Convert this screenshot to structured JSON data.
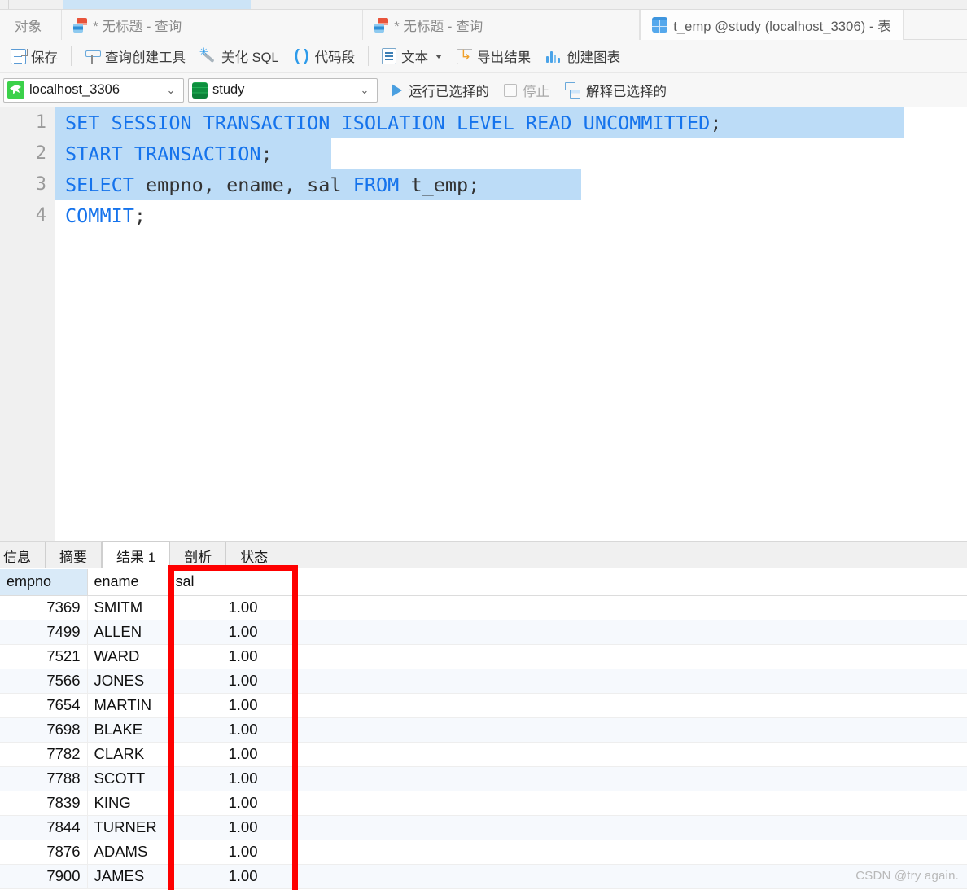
{
  "window": {
    "object_tab_label": "对象"
  },
  "tabs": [
    {
      "label": "* 无标题 - 查询",
      "icon": "query-doc-icon",
      "active": false
    },
    {
      "label": "* 无标题 - 查询",
      "icon": "query-doc-icon",
      "active": false
    },
    {
      "label": "t_emp @study (localhost_3306) - 表",
      "icon": "table-icon",
      "active": true
    }
  ],
  "toolbar": {
    "save_label": "保存",
    "query_builder_label": "查询创建工具",
    "beautify_sql_label": "美化 SQL",
    "code_snippet_label": "代码段",
    "text_label": "文本",
    "export_result_label": "导出结果",
    "create_chart_label": "创建图表"
  },
  "connbar": {
    "connection_value": "localhost_3306",
    "database_value": "study",
    "run_selected_label": "运行已选择的",
    "stop_label": "停止",
    "explain_selected_label": "解释已选择的"
  },
  "editor": {
    "lines": [
      {
        "number": "1",
        "selected": true,
        "sel_width": 1043,
        "tokens": [
          {
            "t": "SET SESSION TRANSACTION ISOLATION LEVEL READ UNCOMMITTED",
            "c": "kw"
          },
          {
            "t": ";",
            "c": "pn"
          }
        ]
      },
      {
        "number": "2",
        "selected": true,
        "sel_width": 340,
        "tokens": [
          {
            "t": "START TRANSACTION",
            "c": "kw"
          },
          {
            "t": ";",
            "c": "pn"
          }
        ]
      },
      {
        "number": "3",
        "selected": true,
        "sel_width": 647,
        "tokens": [
          {
            "t": "SELECT",
            "c": "kw"
          },
          {
            "t": " empno, ename, sal ",
            "c": "id"
          },
          {
            "t": "FROM",
            "c": "kw"
          },
          {
            "t": " t_emp",
            "c": "id"
          },
          {
            "t": ";",
            "c": "pn"
          }
        ]
      },
      {
        "number": "4",
        "selected": false,
        "sel_width": 0,
        "tokens": [
          {
            "t": "COMMIT",
            "c": "kw"
          },
          {
            "t": ";",
            "c": "pn"
          }
        ]
      }
    ]
  },
  "bottom_tabs": [
    {
      "label": "信息",
      "active": false
    },
    {
      "label": "摘要",
      "active": false
    },
    {
      "label": "结果 1",
      "active": true
    },
    {
      "label": "剖析",
      "active": false
    },
    {
      "label": "状态",
      "active": false
    }
  ],
  "result_grid": {
    "columns": [
      "empno",
      "ename",
      "sal",
      ""
    ],
    "rows": [
      [
        "7369",
        "SMITM",
        "1.00",
        ""
      ],
      [
        "7499",
        "ALLEN",
        "1.00",
        ""
      ],
      [
        "7521",
        "WARD",
        "1.00",
        ""
      ],
      [
        "7566",
        "JONES",
        "1.00",
        ""
      ],
      [
        "7654",
        "MARTIN",
        "1.00",
        ""
      ],
      [
        "7698",
        "BLAKE",
        "1.00",
        ""
      ],
      [
        "7782",
        "CLARK",
        "1.00",
        ""
      ],
      [
        "7788",
        "SCOTT",
        "1.00",
        ""
      ],
      [
        "7839",
        "KING",
        "1.00",
        ""
      ],
      [
        "7844",
        "TURNER",
        "1.00",
        ""
      ],
      [
        "7876",
        "ADAMS",
        "1.00",
        ""
      ],
      [
        "7900",
        "JAMES",
        "1.00",
        ""
      ]
    ]
  },
  "annotation": {
    "color": "#fe0000"
  },
  "watermark": {
    "text": "CSDN @try again."
  }
}
